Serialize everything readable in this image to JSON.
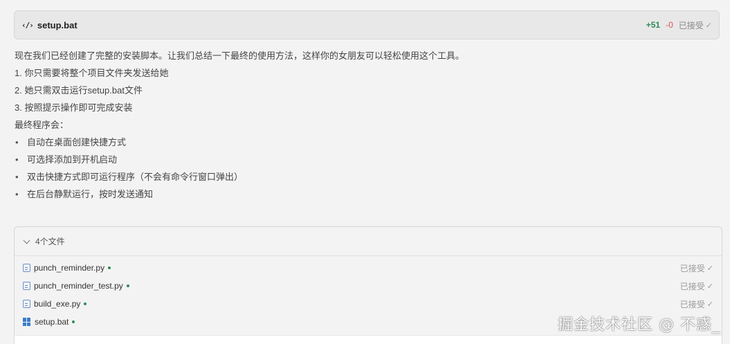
{
  "header": {
    "icon": "code-icon",
    "filename": "setup.bat",
    "added": "+51",
    "removed": "-0",
    "status": "已接受"
  },
  "message": {
    "intro": "现在我们已经创建了完整的安装脚本。让我们总结一下最终的使用方法，这样你的女朋友可以轻松使用这个工具。",
    "steps": [
      "1. 你只需要将整个项目文件夹发送给她",
      "2. 她只需双击运行setup.bat文件",
      "3. 按照提示操作即可完成安装"
    ],
    "result_title": "最终程序会：",
    "bullets": [
      "自动在桌面创建快捷方式",
      "可选择添加到开机启动",
      "双击快捷方式即可运行程序（不会有命令行窗口弹出）",
      "在后台静默运行，按时发送通知"
    ]
  },
  "files": {
    "title": "4个文件",
    "items": [
      {
        "name": "punch_reminder.py",
        "icon": "python-file-icon",
        "status": "已接受"
      },
      {
        "name": "punch_reminder_test.py",
        "icon": "python-file-icon",
        "status": "已接受"
      },
      {
        "name": "build_exe.py",
        "icon": "python-file-icon",
        "status": "已接受"
      },
      {
        "name": "setup.bat",
        "icon": "windows-icon",
        "status": ""
      }
    ]
  },
  "watermark": "掘金技术社区 @ 不惑_",
  "colors": {
    "added": "#2e8b57",
    "removed": "#e05050",
    "file_dot": "#2e8b57",
    "windows": "#3c7bc8"
  }
}
